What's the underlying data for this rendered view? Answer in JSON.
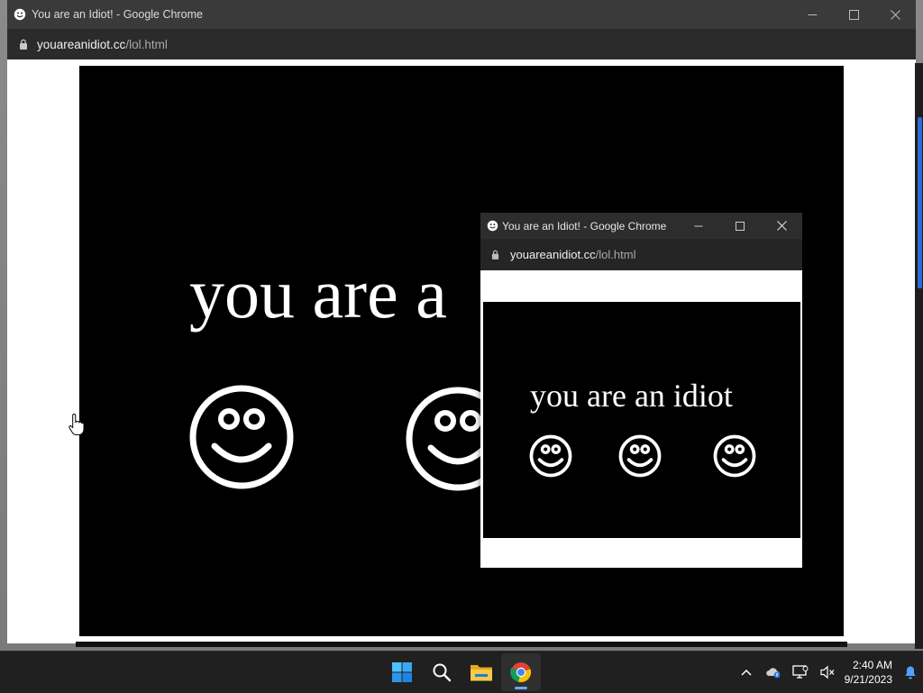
{
  "outer_window": {
    "title": "You are an Idiot! - Google Chrome",
    "url_domain": "youareanidiot.cc",
    "url_path": "/lol.html",
    "message": "you are a"
  },
  "popup_window": {
    "title": "You are an Idiot! - Google Chrome",
    "url_domain": "youareanidiot.cc",
    "url_path": "/lol.html",
    "message": "you are an idiot"
  },
  "taskbar": {
    "apps": [
      "start-icon",
      "search-icon",
      "file-explorer-icon",
      "chrome-icon"
    ],
    "active_app": "chrome-icon",
    "tray_icons": [
      "chevron-up-icon",
      "onedrive-icon",
      "network-icon",
      "speaker-muted-icon"
    ],
    "time": "2:40 AM",
    "date": "9/21/2023",
    "notification_icon": "bell-icon"
  },
  "colors": {
    "titlebar": "#3a3a3a",
    "urlbar": "#2b2b2b",
    "page_black": "#000000",
    "taskbar": "#202020",
    "accent": "#6aa9ff"
  }
}
